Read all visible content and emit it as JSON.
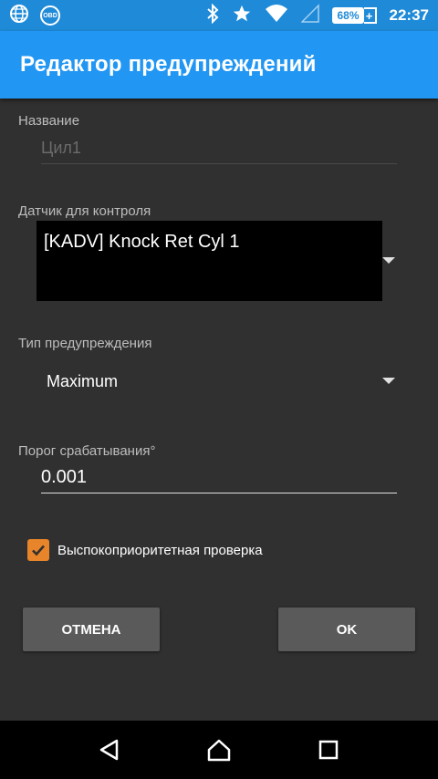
{
  "status_bar": {
    "obd_label": "OBD",
    "battery_percent": "68%",
    "battery_plus": "+",
    "time": "22:37",
    "icons": [
      "globe-icon",
      "obd-icon",
      "bluetooth-icon",
      "star-icon",
      "wifi-icon",
      "signal-icon",
      "battery-icon"
    ]
  },
  "app_bar": {
    "title": "Редактор предупреждений",
    "color": "#2196f3"
  },
  "form": {
    "name_label": "Название",
    "name_placeholder": "Цил1",
    "sensor_label": "Датчик для контроля",
    "sensor_value": "[KADV] Knock Ret Cyl 1",
    "type_label": "Тип предупреждения",
    "type_value": "Maximum",
    "threshold_label": "Порог срабатывания°",
    "threshold_value": "0.001",
    "checkbox_label": "Выспокоприоритетная проверка",
    "checkbox_checked": true,
    "checkbox_color": "#e8852a"
  },
  "buttons": {
    "cancel_label": "ОТМЕНА",
    "ok_label": "OK"
  },
  "nav_bar": {
    "icons": [
      "back-icon",
      "home-icon",
      "recents-icon"
    ]
  }
}
